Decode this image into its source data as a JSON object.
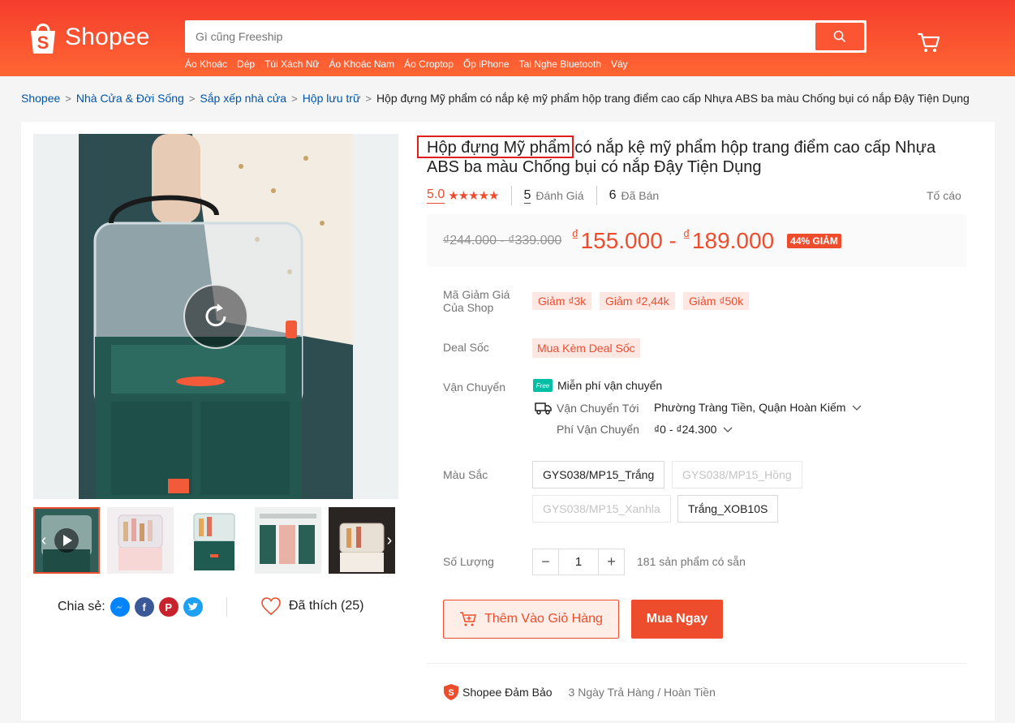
{
  "header": {
    "logo_text": "Shopee",
    "search_placeholder": "Gì cũng Freeship",
    "links": [
      "Áo Khoác",
      "Dép",
      "Túi Xách Nữ",
      "Áo Khoác Nam",
      "Áo Croptop",
      "Ốp iPhone",
      "Tai Nghe Bluetooth",
      "Váy"
    ]
  },
  "breadcrumb": {
    "items": [
      "Shopee",
      "Nhà Cửa & Đời Sống",
      "Sắp xếp nhà cửa",
      "Hộp lưu trữ"
    ],
    "current": "Hộp đựng Mỹ phẩm có nắp kệ mỹ phẩm hộp trang điểm cao cấp Nhựa ABS ba màu Chống bụi có nắp Đậy Tiện Dụng"
  },
  "product": {
    "title": "Hộp đựng Mỹ phẩm có nắp kệ mỹ phẩm hộp trang điểm cao cấp Nhựa ABS ba màu Chống bụi có nắp Đậy Tiện Dụng",
    "rating": "5.0",
    "stars": "★★★★★",
    "reviews_count": "5",
    "reviews_label": "Đánh Giá",
    "sold_count": "6",
    "sold_label": "Đã Bán",
    "report": "Tố cáo",
    "old_price": "₫244.000 - ₫339.000",
    "price_currency": "₫",
    "price_low": "155.000",
    "price_sep": " - ",
    "price_high": "189.000",
    "discount": "44% GIẢM"
  },
  "voucher": {
    "label": "Mã Giảm Giá Của Shop",
    "items": [
      "Giảm ₫3k",
      "Giảm ₫2,44k",
      "Giảm ₫50k"
    ]
  },
  "deal": {
    "label": "Deal Sốc",
    "value": "Mua Kèm Deal Sốc"
  },
  "shipping": {
    "label": "Vận Chuyển",
    "free_badge": "Free",
    "free_text": "Miễn phí vận chuyển",
    "to_label": "Vận Chuyển Tới",
    "to_value": "Phường Tràng Tiền, Quận Hoàn Kiếm",
    "fee_label": "Phí Vận Chuyển",
    "fee_value": "₫0 - ₫24.300"
  },
  "color": {
    "label": "Màu Sắc",
    "options": [
      "GYS038/MP15_Trắng",
      "GYS038/MP15_Hồng",
      "GYS038/MP15_Xanhla",
      "Trắng_XOB10S"
    ]
  },
  "quantity": {
    "label": "Số Lượng",
    "minus": "−",
    "plus": "+",
    "value": "1",
    "stock": "181 sản phẩm có sẵn"
  },
  "actions": {
    "add_to_cart": "Thêm Vào Giỏ Hàng",
    "buy_now": "Mua Ngay"
  },
  "share": {
    "label": "Chia sẻ:",
    "liked": "Đã thích (25)"
  },
  "guarantee": {
    "title": "Shopee Đảm Bảo",
    "subtitle": "3 Ngày Trả Hàng / Hoàn Tiền"
  },
  "colors": {
    "brand": "#ee4d2d",
    "link": "#0055aa"
  }
}
